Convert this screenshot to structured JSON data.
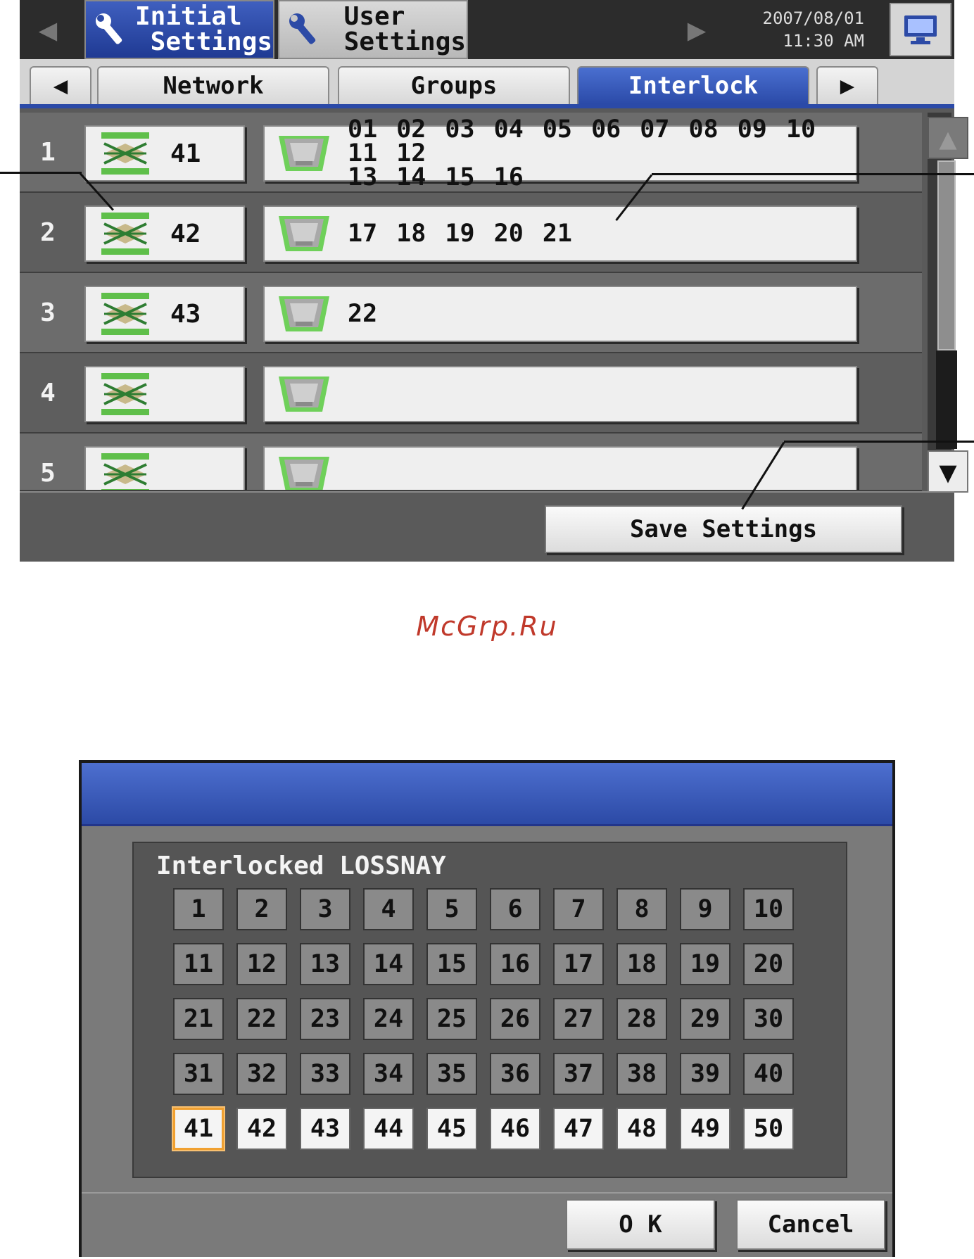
{
  "header": {
    "tabs": [
      {
        "label": "Initial\n Settings",
        "active": true
      },
      {
        "label": " User\n Settings",
        "active": false
      }
    ],
    "date": "2007/08/01",
    "time": "11:30 AM"
  },
  "page_tabs": [
    "Network",
    "Groups",
    "Interlock"
  ],
  "active_tab": "Interlock",
  "rows": [
    {
      "index": "1",
      "lossnay": "41",
      "units_line1": "01 02 03 04 05 06 07 08 09 10 11 12",
      "units_line2": "13 14 15 16"
    },
    {
      "index": "2",
      "lossnay": "42",
      "units_line1": "17 18 19 20 21",
      "units_line2": ""
    },
    {
      "index": "3",
      "lossnay": "43",
      "units_line1": "22",
      "units_line2": ""
    },
    {
      "index": "4",
      "lossnay": "",
      "units_line1": "",
      "units_line2": ""
    },
    {
      "index": "5",
      "lossnay": "",
      "units_line1": "",
      "units_line2": ""
    }
  ],
  "save_button": "Save Settings",
  "watermark": "McGrp.Ru",
  "dialog": {
    "heading": "Interlocked LOSSNAY",
    "numbers": [
      "1",
      "2",
      "3",
      "4",
      "5",
      "6",
      "7",
      "8",
      "9",
      "10",
      "11",
      "12",
      "13",
      "14",
      "15",
      "16",
      "17",
      "18",
      "19",
      "20",
      "21",
      "22",
      "23",
      "24",
      "25",
      "26",
      "27",
      "28",
      "29",
      "30",
      "31",
      "32",
      "33",
      "34",
      "35",
      "36",
      "37",
      "38",
      "39",
      "40",
      "41",
      "42",
      "43",
      "44",
      "45",
      "46",
      "47",
      "48",
      "49",
      "50"
    ],
    "enabled_from": 41,
    "selected": "41",
    "ok_label": "O K",
    "cancel_label": "Cancel"
  },
  "colors": {
    "title_blue": "#2c4aa6",
    "selection_orange": "#f0a030",
    "icon_green": "#5fbf4a",
    "watermark_red": "#c0392b"
  }
}
